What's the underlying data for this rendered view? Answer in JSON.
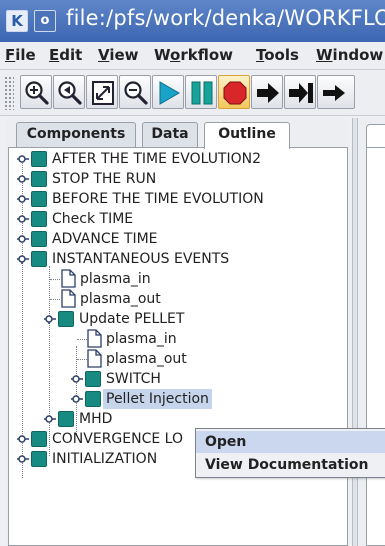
{
  "window": {
    "title": "file:/pfs/work/denka/WORKFLO"
  },
  "menubar": {
    "items": [
      {
        "label": "File",
        "mn": "F",
        "rest": "ile"
      },
      {
        "label": "Edit",
        "mn": "E",
        "rest": "dit"
      },
      {
        "label": "View",
        "mn": "V",
        "rest": "iew"
      },
      {
        "label": "Workflow",
        "mn": "o",
        "pre": "W",
        "rest": "rkflow"
      },
      {
        "label": "Tools",
        "mn": "T",
        "rest": "ools"
      },
      {
        "label": "Window",
        "mn": "W",
        "rest": "indow"
      }
    ]
  },
  "toolbar": {
    "buttons": [
      "zoom-in",
      "zoom-back",
      "fit-page",
      "zoom-out",
      "run",
      "pause",
      "stop",
      "step",
      "step-end",
      "next"
    ]
  },
  "tabs": [
    "Components",
    "Data",
    "Outline"
  ],
  "active_tab": "Outline",
  "tree": [
    {
      "label": "AFTER THE TIME EVOLUTION2",
      "type": "folder",
      "state": "collapsed"
    },
    {
      "label": "STOP THE RUN",
      "type": "folder",
      "state": "collapsed"
    },
    {
      "label": "BEFORE THE TIME EVOLUTION",
      "type": "folder",
      "state": "collapsed"
    },
    {
      "label": "Check TIME",
      "type": "folder",
      "state": "collapsed"
    },
    {
      "label": "ADVANCE TIME",
      "type": "folder",
      "state": "collapsed"
    },
    {
      "label": "INSTANTANEOUS EVENTS",
      "type": "folder",
      "state": "expanded"
    },
    {
      "label": "plasma_in",
      "type": "file"
    },
    {
      "label": "plasma_out",
      "type": "file"
    },
    {
      "label": "Update PELLET",
      "type": "folder",
      "state": "expanded"
    },
    {
      "label": "plasma_in",
      "type": "file"
    },
    {
      "label": "plasma_out",
      "type": "file"
    },
    {
      "label": "SWITCH",
      "type": "folder",
      "state": "collapsed"
    },
    {
      "label": "Pellet Injection",
      "type": "folder",
      "state": "collapsed",
      "selected": true
    },
    {
      "label": "MHD",
      "type": "folder",
      "state": "collapsed"
    },
    {
      "label": "CONVERGENCE LO",
      "type": "folder",
      "state": "collapsed"
    },
    {
      "label": "INITIALIZATION",
      "type": "folder",
      "state": "collapsed"
    }
  ],
  "context_menu": {
    "items": [
      "Open",
      "View Documentation"
    ],
    "highlighted": "Open"
  },
  "colors": {
    "titlebar": "#3c66b2",
    "node": "#178b82",
    "selection": "#c7d5ec",
    "stop": "#d8262a",
    "run": "#1aa3c8"
  }
}
